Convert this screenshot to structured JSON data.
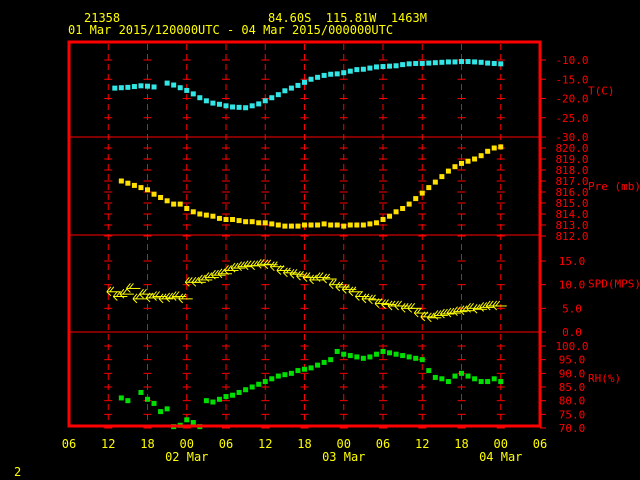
{
  "header": {
    "station_id": "21358",
    "location": "84.60S  115.81W  1463M",
    "time_range": "01 Mar 2015/120000UTC - 04 Mar 2015/000000UTC"
  },
  "page_number": "2",
  "colors": {
    "frame": "#ff0000",
    "grid": "#ff0000",
    "axis_text": "#ffff00",
    "temperature": "#33e6e6",
    "pressure": "#ffe000",
    "wind": "#ffff00",
    "humidity": "#00e000"
  },
  "x_axis": {
    "hour_ticks": [
      "06",
      "12",
      "18",
      "00",
      "06",
      "12",
      "18",
      "00",
      "06",
      "12",
      "18",
      "00",
      "06"
    ],
    "day_labels": [
      "02 Mar",
      "03 Mar",
      "04 Mar"
    ]
  },
  "chart_data": [
    {
      "type": "scatter",
      "xunit": "hours since 01 Mar 2015 06 UTC",
      "ylabel": "T(C)",
      "ylim": [
        -30,
        -10
      ],
      "yticks": [
        "-10.0",
        "-15.0",
        "-20.0",
        "-25.0",
        "-30.0"
      ],
      "series": [
        {
          "x": [
            7,
            8,
            9,
            10,
            11,
            12,
            13,
            15,
            16,
            17,
            18,
            19,
            20,
            21,
            22,
            23,
            24,
            25,
            26,
            27,
            28,
            29,
            30,
            31,
            32,
            33,
            34,
            35,
            36,
            37,
            38,
            39,
            40,
            41,
            42,
            43,
            44,
            45,
            46,
            47,
            48,
            49,
            50,
            51,
            52,
            53,
            54,
            55,
            56,
            57,
            58,
            59,
            60,
            61,
            62,
            63,
            64,
            65,
            66
          ],
          "values": [
            -17.3,
            -17.2,
            -17.1,
            -16.9,
            -16.7,
            -16.8,
            -17.0,
            -16.0,
            -16.5,
            -17.2,
            -17.9,
            -18.8,
            -19.8,
            -20.6,
            -21.2,
            -21.5,
            -21.9,
            -22.2,
            -22.3,
            -22.4,
            -21.9,
            -21.4,
            -20.6,
            -19.8,
            -19.0,
            -18.0,
            -17.3,
            -16.6,
            -15.8,
            -15.0,
            -14.5,
            -14.0,
            -13.7,
            -13.6,
            -13.3,
            -12.9,
            -12.5,
            -12.4,
            -12.1,
            -11.8,
            -11.7,
            -11.6,
            -11.5,
            -11.2,
            -11.0,
            -10.9,
            -10.9,
            -10.8,
            -10.7,
            -10.6,
            -10.5,
            -10.5,
            -10.4,
            -10.4,
            -10.5,
            -10.6,
            -10.8,
            -10.9,
            -11.0
          ]
        }
      ]
    },
    {
      "type": "scatter",
      "xunit": "hours since 01 Mar 2015 06 UTC",
      "ylabel": "Pre (mb)",
      "ylim": [
        812,
        820
      ],
      "yticks": [
        "820.0",
        "819.0",
        "818.0",
        "817.0",
        "816.0",
        "815.0",
        "814.0",
        "813.0",
        "812.0"
      ],
      "series": [
        {
          "x": [
            8,
            9,
            10,
            11,
            12,
            13,
            14,
            15,
            16,
            17,
            18,
            19,
            20,
            21,
            22,
            23,
            24,
            25,
            26,
            27,
            28,
            29,
            30,
            31,
            32,
            33,
            34,
            35,
            36,
            37,
            38,
            39,
            40,
            41,
            42,
            43,
            44,
            45,
            46,
            47,
            48,
            49,
            50,
            51,
            52,
            53,
            54,
            55,
            56,
            57,
            58,
            59,
            60,
            61,
            62,
            63,
            64,
            65,
            66
          ],
          "values": [
            817.0,
            816.8,
            816.6,
            816.4,
            816.2,
            815.8,
            815.5,
            815.2,
            814.9,
            814.9,
            814.5,
            814.2,
            814.0,
            813.9,
            813.8,
            813.6,
            813.5,
            813.5,
            813.4,
            813.3,
            813.3,
            813.2,
            813.2,
            813.1,
            813.0,
            812.9,
            812.9,
            812.9,
            813.0,
            813.0,
            813.0,
            813.1,
            813.0,
            813.0,
            812.9,
            813.0,
            813.0,
            813.0,
            813.1,
            813.2,
            813.5,
            813.8,
            814.2,
            814.5,
            814.9,
            815.4,
            815.9,
            816.4,
            816.9,
            817.4,
            817.9,
            818.3,
            818.6,
            818.8,
            819.0,
            819.3,
            819.7,
            820.0,
            820.1
          ]
        }
      ]
    },
    {
      "type": "scatter",
      "xunit": "hours since 01 Mar 2015 06 UTC",
      "ylabel": "SPD(MPS)",
      "ylim": [
        0,
        15
      ],
      "yticks": [
        "15.0",
        "10.0",
        "5.0",
        "0.0"
      ],
      "series": [
        {
          "x": [
            7,
            8,
            9,
            10,
            11,
            12,
            13,
            14,
            15,
            16,
            17,
            18,
            19,
            20,
            21,
            22,
            23,
            24,
            25,
            26,
            27,
            28,
            29,
            30,
            31,
            32,
            33,
            34,
            35,
            36,
            37,
            38,
            39,
            40,
            41,
            42,
            43,
            44,
            45,
            46,
            47,
            48,
            49,
            50,
            51,
            52,
            53,
            54,
            55,
            56,
            57,
            58,
            59,
            60,
            61,
            62,
            63,
            64,
            65,
            66
          ],
          "values": [
            8.5,
            7.5,
            8.0,
            9.2,
            7.0,
            8.0,
            7.2,
            7.5,
            7.0,
            7.2,
            7.5,
            7.0,
            10.5,
            10.5,
            11.0,
            11.5,
            12.0,
            12.3,
            13.0,
            13.5,
            13.8,
            14.0,
            14.0,
            14.3,
            14.2,
            13.8,
            13.0,
            12.5,
            12.2,
            11.8,
            11.5,
            11.0,
            11.5,
            11.2,
            10.0,
            9.5,
            9.0,
            8.5,
            7.5,
            7.0,
            6.8,
            6.0,
            5.8,
            5.5,
            5.5,
            5.0,
            5.0,
            4.0,
            3.2,
            3.0,
            3.5,
            3.8,
            4.0,
            4.3,
            4.5,
            5.0,
            4.8,
            5.2,
            5.5,
            5.5
          ]
        }
      ]
    },
    {
      "type": "scatter",
      "xunit": "hours since 01 Mar 2015 06 UTC",
      "ylabel": "RH(%)",
      "ylim": [
        70,
        100
      ],
      "yticks": [
        "100.0",
        "95.0",
        "90.0",
        "85.0",
        "80.0",
        "75.0",
        "70.0"
      ],
      "series": [
        {
          "x": [
            8,
            9,
            11,
            12,
            13,
            14,
            15,
            16,
            17,
            18,
            19,
            20,
            21,
            22,
            23,
            24,
            25,
            26,
            27,
            28,
            29,
            30,
            31,
            32,
            33,
            34,
            35,
            36,
            37,
            38,
            39,
            40,
            41,
            42,
            43,
            44,
            45,
            46,
            47,
            48,
            49,
            50,
            51,
            52,
            53,
            54,
            55,
            56,
            57,
            58,
            59,
            60,
            61,
            62,
            63,
            64,
            65,
            66
          ],
          "values": [
            81.0,
            80.0,
            83.0,
            80.5,
            79.0,
            76.0,
            77.0,
            70.5,
            71.0,
            73.0,
            72.0,
            70.5,
            80.0,
            79.5,
            80.5,
            81.5,
            82.0,
            83.0,
            84.0,
            85.0,
            86.0,
            87.0,
            88.0,
            89.0,
            89.5,
            90.0,
            91.0,
            91.5,
            92.0,
            93.0,
            94.0,
            95.0,
            98.0,
            97.0,
            96.5,
            96.0,
            95.5,
            96.0,
            97.0,
            98.0,
            97.5,
            97.0,
            96.5,
            96.0,
            95.5,
            95.0,
            91.0,
            88.5,
            88.0,
            87.0,
            89.0,
            90.0,
            89.0,
            88.0,
            87.0,
            87.0,
            88.0,
            87.0
          ]
        }
      ]
    }
  ]
}
